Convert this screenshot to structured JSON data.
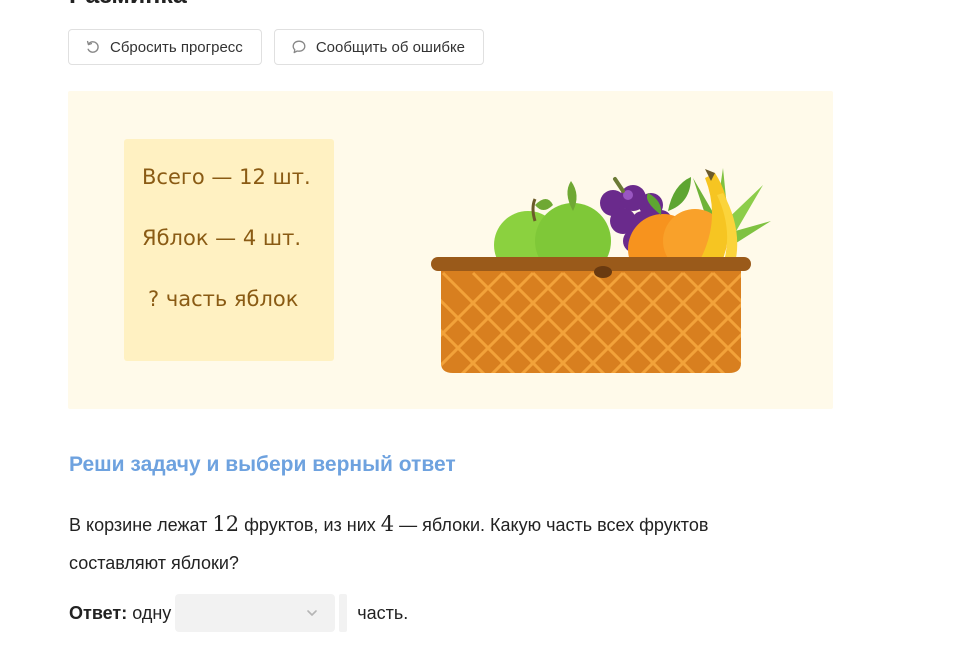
{
  "header": {
    "title": "Разминка"
  },
  "toolbar": {
    "reset_label": "Сбросить прогресс",
    "report_label": "Сообщить об ошибке"
  },
  "illustration": {
    "card_lines": [
      "Всего — 12 шт.",
      "Яблок — 4 шт.",
      "? часть яблок"
    ],
    "image": "fruit-basket"
  },
  "task": {
    "subtitle": "Реши задачу и выбери верный ответ",
    "text_1": "В корзине лежат ",
    "num_1": "12",
    "text_2": " фруктов, из них ",
    "num_2": "4",
    "text_3": " — яблоки. Какую часть всех фруктов составляют яблоки?"
  },
  "answer": {
    "label": "Ответ:",
    "before": "одну",
    "select_value": "",
    "after": "часть."
  },
  "colors": {
    "accent_blue": "#6ea2df",
    "banner_bg": "#fffaea",
    "card_bg": "#fff1c2",
    "card_text": "#8a5b14"
  }
}
